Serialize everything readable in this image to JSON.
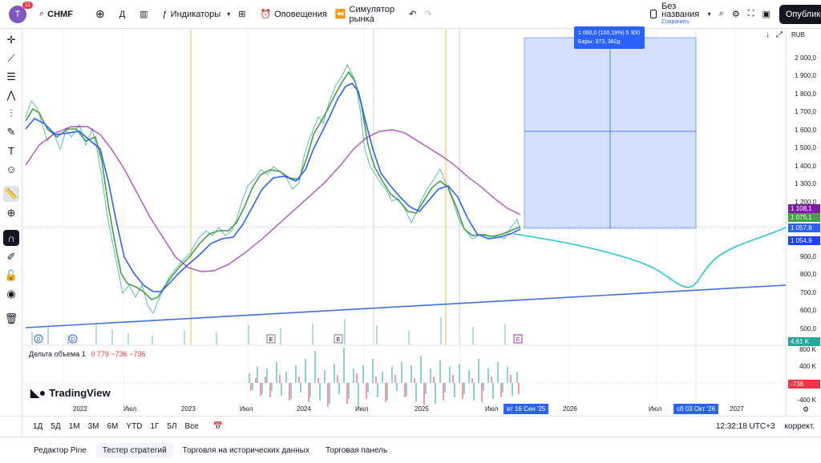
{
  "header": {
    "avatar_letter": "T",
    "notifications": "11",
    "symbol": "CHMF",
    "interval": "Д",
    "indicators": "Индикаторы",
    "alerts": "Оповещения",
    "replay": "Симулятор рынка",
    "layout_name": "Без названия",
    "layout_status": "Сохранить",
    "publish": "Опубликовать"
  },
  "price_axis": {
    "currency": "RUB",
    "ticks": [
      "2 000,0",
      "1 900,0",
      "1 800,0",
      "1 700,0",
      "1 600,0",
      "1 500,0",
      "1 400,0",
      "1 300,0",
      "1 200,0",
      "900,0",
      "800,0",
      "700,0",
      "600,0",
      "500,0"
    ],
    "tags": [
      {
        "label": "1 108,1",
        "color": "#7b1fa2"
      },
      {
        "label": "1 075,1",
        "color": "#43a047"
      },
      {
        "label": "1 057,8",
        "color": "#2962ff"
      },
      {
        "label": "1 054,9",
        "color": "#1e40ff"
      },
      {
        "label": "4,61 K",
        "color": "#26a69a"
      },
      {
        "label": "-736",
        "color": "#f23645"
      }
    ],
    "volume_ticks": [
      "800 K",
      "400 K",
      "-400 K"
    ]
  },
  "measure_tooltip": {
    "line1": "1 060,0 (100,19%) 5 300",
    "line2": "Бары: 373, 382д"
  },
  "volume_indicator": {
    "name": "Дельта объема",
    "param": "1",
    "values": "0  779  −736  −736"
  },
  "logo_text": "TradingView",
  "x_axis": {
    "ticks": [
      "2022",
      "Июл",
      "2023",
      "Июл",
      "2024",
      "Июл",
      "2025",
      "Июл",
      "2026",
      "Июл",
      "2027"
    ],
    "highlight_start": "вт 16 Сен '25",
    "highlight_end": "сб 03 Окт '26"
  },
  "bottom": {
    "timeframes": [
      "1Д",
      "5Д",
      "1М",
      "3М",
      "6М",
      "YTD",
      "1Г",
      "5Л",
      "Все"
    ],
    "clock": "12:32:18 UTC+3",
    "adjust": "коррект."
  },
  "panel_tabs": [
    "Редактор Pine",
    "Тестер стратегий",
    "Торговля на исторических данных",
    "Торговая панель"
  ],
  "markers": {
    "dividend": "D",
    "earnings": "E"
  },
  "colors": {
    "accent": "#2962ff",
    "ma_fast": "#43a047",
    "ma_mid": "#2962ff",
    "ma_slow": "#9c27b0",
    "forecast": "#26c6da",
    "trend": "#3f6fe0",
    "measure_fill": "#c6d6fb"
  }
}
